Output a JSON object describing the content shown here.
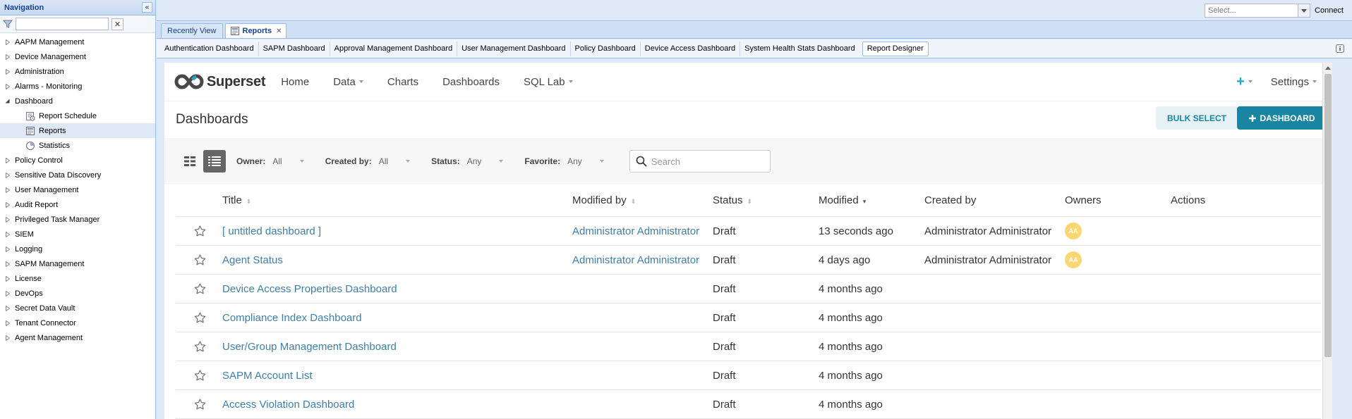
{
  "nav": {
    "title": "Navigation",
    "filter_value": "",
    "items": [
      {
        "label": "AAPM Management",
        "expanded": false
      },
      {
        "label": "Device Management",
        "expanded": false
      },
      {
        "label": "Administration",
        "expanded": false
      },
      {
        "label": "Alarms - Monitoring",
        "expanded": false
      },
      {
        "label": "Dashboard",
        "expanded": true
      },
      {
        "label": "Policy Control",
        "expanded": false
      },
      {
        "label": "Sensitive Data Discovery",
        "expanded": false
      },
      {
        "label": "User Management",
        "expanded": false
      },
      {
        "label": "Audit Report",
        "expanded": false
      },
      {
        "label": "Privileged Task Manager",
        "expanded": false
      },
      {
        "label": "SIEM",
        "expanded": false
      },
      {
        "label": "Logging",
        "expanded": false
      },
      {
        "label": "SAPM Management",
        "expanded": false
      },
      {
        "label": "License",
        "expanded": false
      },
      {
        "label": "DevOps",
        "expanded": false
      },
      {
        "label": "Secret Data Vault",
        "expanded": false
      },
      {
        "label": "Tenant Connector",
        "expanded": false
      },
      {
        "label": "Agent Management",
        "expanded": false
      }
    ],
    "dashboard_children": [
      {
        "label": "Report Schedule",
        "icon": "report-schedule-icon"
      },
      {
        "label": "Reports",
        "icon": "reports-icon",
        "selected": true
      },
      {
        "label": "Statistics",
        "icon": "statistics-icon"
      }
    ]
  },
  "topbar": {
    "select_placeholder": "Select...",
    "connect_label": "Connect"
  },
  "main_tabs": [
    {
      "label": "Recently View",
      "active": false
    },
    {
      "label": "Reports",
      "active": true,
      "closable": true
    }
  ],
  "dashboard_tabs": [
    {
      "label": "Authentication Dashboard"
    },
    {
      "label": "SAPM Dashboard"
    },
    {
      "label": "Approval Management Dashboard"
    },
    {
      "label": "User Management Dashboard"
    },
    {
      "label": "Policy Dashboard"
    },
    {
      "label": "Device Access Dashboard"
    },
    {
      "label": "System Health Stats Dashboard"
    },
    {
      "label": "Report Designer",
      "active": true
    }
  ],
  "superset": {
    "brand": "Superset",
    "menu": [
      {
        "label": "Home",
        "dropdown": false
      },
      {
        "label": "Data",
        "dropdown": true
      },
      {
        "label": "Charts",
        "dropdown": false
      },
      {
        "label": "Dashboards",
        "dropdown": false
      },
      {
        "label": "SQL Lab",
        "dropdown": true
      }
    ],
    "plus": "+",
    "settings": "Settings",
    "page_title": "Dashboards",
    "bulk_select": "BULK SELECT",
    "new_dashboard": "DASHBOARD",
    "filters": {
      "owner": {
        "label": "Owner:",
        "value": "All"
      },
      "created_by": {
        "label": "Created by:",
        "value": "All"
      },
      "status": {
        "label": "Status:",
        "value": "Any"
      },
      "favorite": {
        "label": "Favorite:",
        "value": "Any"
      },
      "search_placeholder": "Search"
    },
    "columns": {
      "title": "Title",
      "modified_by": "Modified by",
      "status": "Status",
      "modified": "Modified",
      "created_by": "Created by",
      "owners": "Owners",
      "actions": "Actions"
    },
    "rows": [
      {
        "title": "[ untitled dashboard ]",
        "modified_by": "Administrator Administrator",
        "status": "Draft",
        "modified": "13 seconds ago",
        "created_by": "Administrator Administrator",
        "owner": "AA"
      },
      {
        "title": "Agent Status",
        "modified_by": "Administrator Administrator",
        "status": "Draft",
        "modified": "4 days ago",
        "created_by": "Administrator Administrator",
        "owner": "AA"
      },
      {
        "title": "Device Access Properties Dashboard",
        "modified_by": "",
        "status": "Draft",
        "modified": "4 months ago",
        "created_by": "",
        "owner": ""
      },
      {
        "title": "Compliance Index Dashboard",
        "modified_by": "",
        "status": "Draft",
        "modified": "4 months ago",
        "created_by": "",
        "owner": ""
      },
      {
        "title": "User/Group Management Dashboard",
        "modified_by": "",
        "status": "Draft",
        "modified": "4 months ago",
        "created_by": "",
        "owner": ""
      },
      {
        "title": "SAPM Account List",
        "modified_by": "",
        "status": "Draft",
        "modified": "4 months ago",
        "created_by": "",
        "owner": ""
      },
      {
        "title": "Access Violation Dashboard",
        "modified_by": "",
        "status": "Draft",
        "modified": "4 months ago",
        "created_by": "",
        "owner": ""
      }
    ]
  },
  "colors": {
    "accent": "#1a85a0",
    "link": "#3f7ea6",
    "avatar": "#fbd774",
    "ext_header": "#15428b"
  }
}
